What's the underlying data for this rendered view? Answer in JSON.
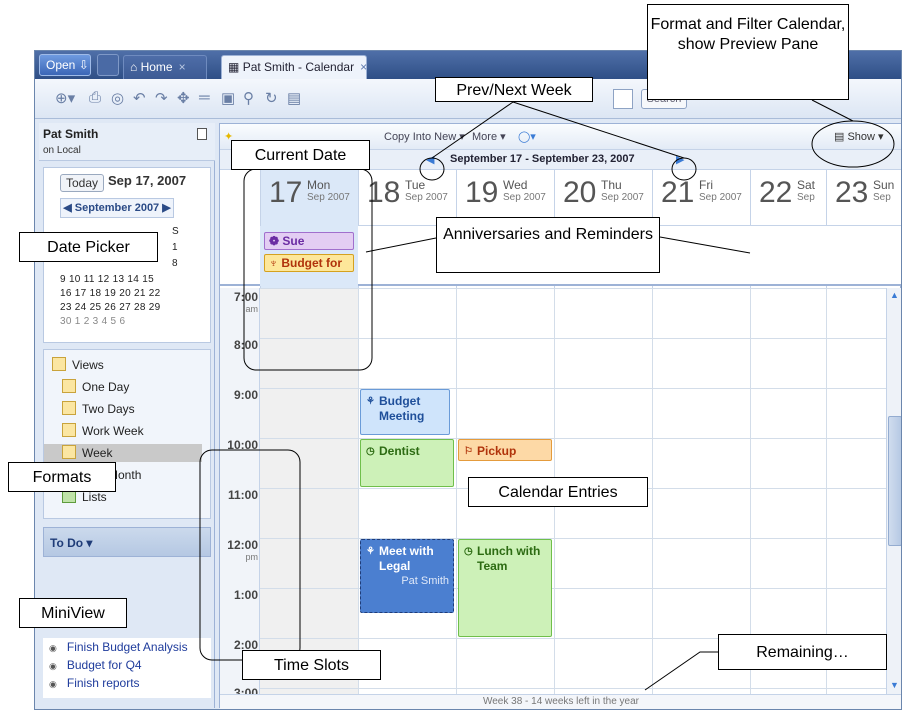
{
  "tabs": {
    "open_label": "Open",
    "home_label": "Home",
    "calendar_label": "Pat Smith - Calendar"
  },
  "search": {
    "button_label": "Search"
  },
  "left": {
    "user": "Pat Smith",
    "location": "on Local",
    "today_button": "Today",
    "current_date": "Sep 17, 2007",
    "month_label": "September 2007",
    "mini_rows": [
      "S",
      "1",
      "8",
      "9 10 11 12 13 14 15",
      "16 17 18 19 20 21 22",
      "23 24 25 26 27 28 29",
      "30  1  2  3  4  5  6"
    ],
    "views_title": "Views",
    "views": [
      "One Day",
      "Two Days",
      "Work Week",
      "Week",
      "One Month",
      "Lists"
    ],
    "todo_title": "To Do ▾",
    "todos": [
      "Finish Budget Analysis",
      "Budget for Q4",
      "Finish reports"
    ]
  },
  "cal_toolbar": {
    "copy_label": "Copy Into New ▾",
    "more_label": "More ▾",
    "show_label": "Show ▾"
  },
  "week": {
    "range": "September 17 - September 23, 2007",
    "footer": "Week 38 - 14 weeks left in the year"
  },
  "days": [
    {
      "num": "17",
      "name": "Mon",
      "sub": "Sep 2007"
    },
    {
      "num": "18",
      "name": "Tue",
      "sub": "Sep 2007"
    },
    {
      "num": "19",
      "name": "Wed",
      "sub": "Sep 2007"
    },
    {
      "num": "20",
      "name": "Thu",
      "sub": "Sep 2007"
    },
    {
      "num": "21",
      "name": "Fri",
      "sub": "Sep 2007"
    },
    {
      "num": "22",
      "name": "Sat",
      "sub": "Sep"
    },
    {
      "num": "23",
      "name": "Sun",
      "sub": "Sep"
    }
  ],
  "reminders": [
    {
      "label": "Sue"
    },
    {
      "label": "Budget for"
    }
  ],
  "times": [
    {
      "t": "7:00",
      "ampm": "am"
    },
    {
      "t": "8:00",
      "ampm": ""
    },
    {
      "t": "9:00",
      "ampm": ""
    },
    {
      "t": "10:00",
      "ampm": ""
    },
    {
      "t": "11:00",
      "ampm": ""
    },
    {
      "t": "12:00",
      "ampm": "pm"
    },
    {
      "t": "1:00",
      "ampm": ""
    },
    {
      "t": "2:00",
      "ampm": ""
    },
    {
      "t": "3:00",
      "ampm": ""
    }
  ],
  "events": {
    "budget_meeting": "Budget Meeting",
    "dentist": "Dentist",
    "pickup": "Pickup",
    "meet_legal": "Meet with Legal",
    "meet_legal_owner": "Pat Smith",
    "lunch": "Lunch with Team"
  },
  "callouts": {
    "format_filter": "Format and Filter Calendar, show Preview Pane",
    "prev_next": "Prev/Next Week",
    "current_date": "Current Date",
    "date_picker": "Date Picker",
    "anniversaries": "Anniversaries and Reminders",
    "formats": "Formats",
    "calendar_entries": "Calendar Entries",
    "miniview": "MiniView",
    "time_slots": "Time Slots",
    "remaining": "Remaining…"
  }
}
